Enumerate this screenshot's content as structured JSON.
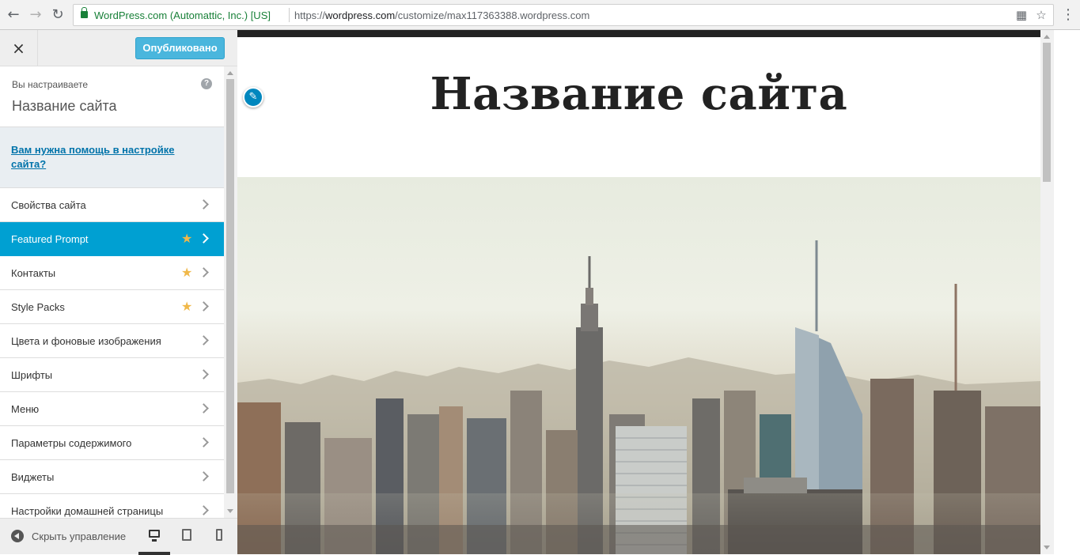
{
  "browser": {
    "certificate": "WordPress.com (Automattic, Inc.) [US]",
    "url_scheme": "https://",
    "url_host": "wordpress.com",
    "url_path": "/customize/max117363388.wordpress.com"
  },
  "header": {
    "close_glyph": "×",
    "publish_label": "Опубликовано"
  },
  "info": {
    "small": "Вы настраиваете",
    "title": "Название сайта",
    "help_glyph": "?"
  },
  "help_link": "Вам нужна помощь в настройке сайта?",
  "menu": [
    {
      "label": "Свойства сайта",
      "star": false,
      "active": false
    },
    {
      "label": "Featured Prompt",
      "star": true,
      "active": true
    },
    {
      "label": "Контакты",
      "star": true,
      "active": false
    },
    {
      "label": "Style Packs",
      "star": true,
      "active": false
    },
    {
      "label": "Цвета и фоновые изображения",
      "star": false,
      "active": false
    },
    {
      "label": "Шрифты",
      "star": false,
      "active": false
    },
    {
      "label": "Меню",
      "star": false,
      "active": false
    },
    {
      "label": "Параметры содержимого",
      "star": false,
      "active": false
    },
    {
      "label": "Виджеты",
      "star": false,
      "active": false
    },
    {
      "label": "Настройки домашней страницы",
      "star": false,
      "active": false
    }
  ],
  "footer": {
    "collapse_label": "Скрыть управление",
    "devices": [
      "desktop-icon",
      "tablet-icon",
      "mobile-icon"
    ],
    "active_device": "desktop"
  },
  "preview": {
    "site_title": "Название сайта",
    "hero_image": "city-skyline"
  },
  "colors": {
    "accent": "#00a0d2",
    "publish": "#4ab6dd",
    "star": "#f0b849",
    "link": "#0073aa"
  }
}
